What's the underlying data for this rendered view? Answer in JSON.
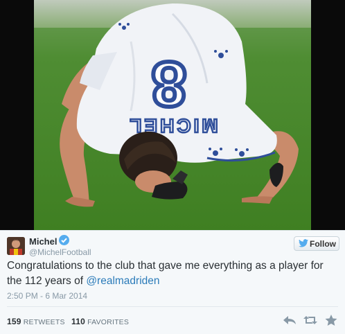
{
  "photo": {
    "jersey_number": "8",
    "jersey_name": "MICHEL",
    "colors": {
      "grass": "#4a8a2b",
      "shirt": "#f1f3f7",
      "print": "#2f4e9a",
      "hair": "#2a1f19",
      "skin": "#c98b6b"
    }
  },
  "tweet": {
    "author_name": "Michel",
    "author_handle": "@MichelFootball",
    "verified": true,
    "follow_label": "Follow",
    "text_before": "Congratulations to the club that gave me everything as a player for the 112 years of ",
    "mention": "@realmadriden",
    "timestamp": "2:50 PM - 6 Mar 2014",
    "retweets_count": "159",
    "retweets_label": "RETWEETS",
    "favorites_count": "110",
    "favorites_label": "FAVORITES",
    "icons": [
      "reply-icon",
      "retweet-icon",
      "favorite-icon",
      "twitter-bird-icon",
      "verified-check-icon"
    ]
  }
}
